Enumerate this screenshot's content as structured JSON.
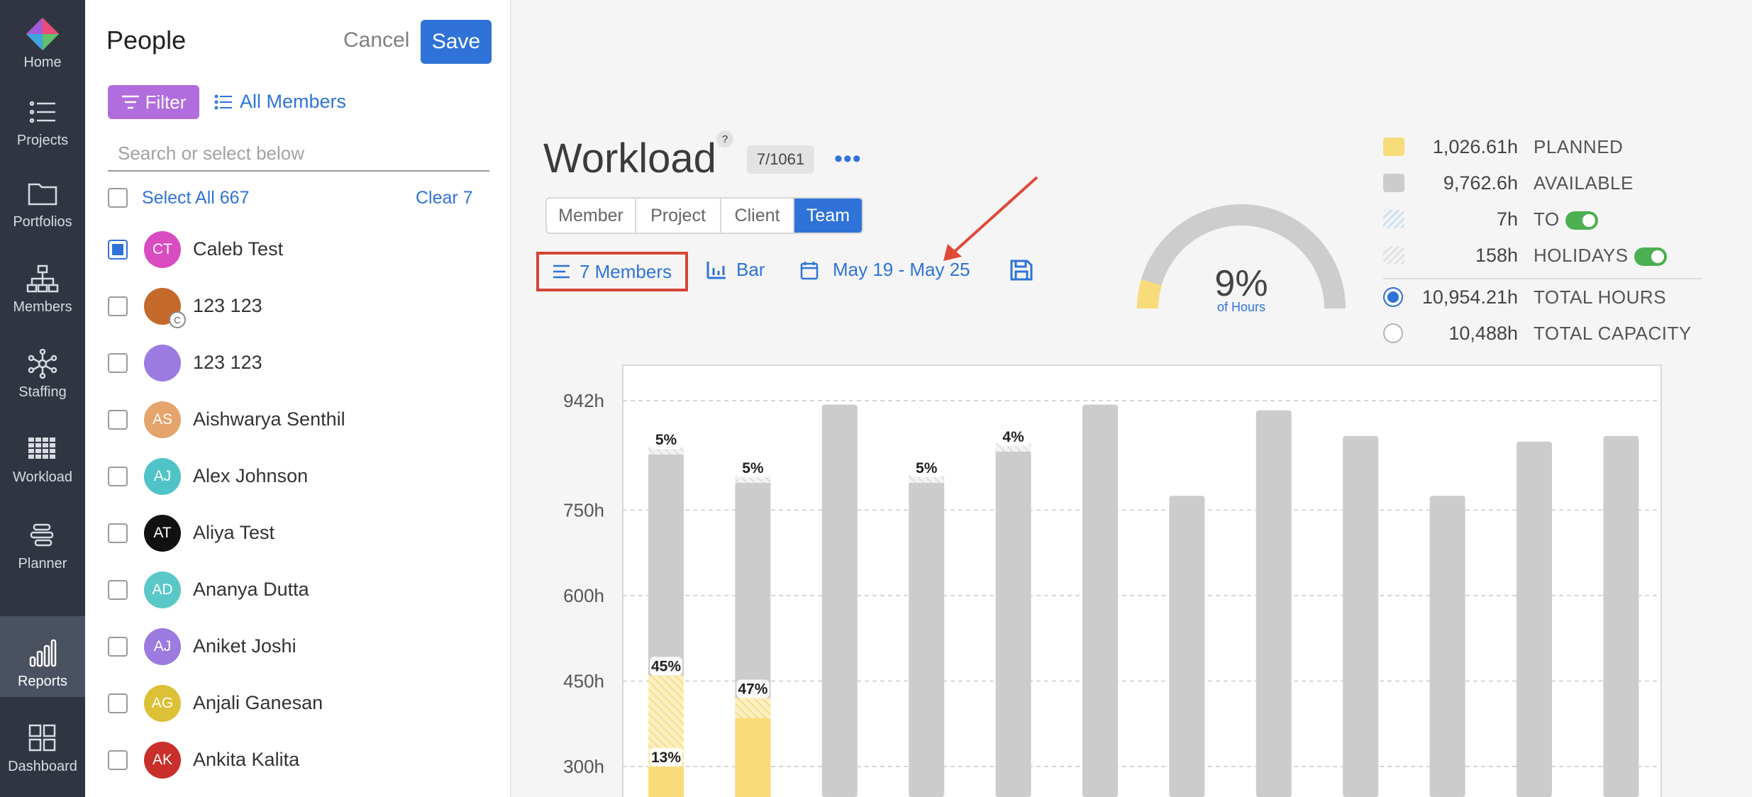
{
  "nav": {
    "items": [
      {
        "label": "Home",
        "icon": "logo-icon"
      },
      {
        "label": "Projects",
        "icon": "list-icon"
      },
      {
        "label": "Portfolios",
        "icon": "folder-icon"
      },
      {
        "label": "Members",
        "icon": "org-chart-icon"
      },
      {
        "label": "Staffing",
        "icon": "network-icon"
      },
      {
        "label": "Workload",
        "icon": "grid-icon"
      },
      {
        "label": "Planner",
        "icon": "planner-icon"
      },
      {
        "label": "Reports",
        "icon": "bar-chart-icon"
      },
      {
        "label": "Dashboard",
        "icon": "dashboard-icon"
      }
    ],
    "active": "Reports"
  },
  "people": {
    "title": "People",
    "cancel": "Cancel",
    "save": "Save",
    "filter": "Filter",
    "all_members": "All Members",
    "search_placeholder": "Search or select below",
    "select_all": "Select All 667",
    "clear": "Clear 7",
    "list": [
      {
        "name": "Caleb Test",
        "initials": "CT",
        "color": "#d94cc0",
        "checked": true
      },
      {
        "name": "123 123",
        "initials": "",
        "color": "#c5692b",
        "checked": false,
        "badge": "C"
      },
      {
        "name": "123 123",
        "initials": "",
        "color": "#9b7be0",
        "checked": false
      },
      {
        "name": "Aishwarya Senthil",
        "initials": "AS",
        "color": "#e5a46b",
        "checked": false
      },
      {
        "name": "Alex Johnson",
        "initials": "AJ",
        "color": "#4fc3c7",
        "checked": false
      },
      {
        "name": "Aliya Test",
        "initials": "AT",
        "color": "#111111",
        "checked": false
      },
      {
        "name": "Ananya Dutta",
        "initials": "AD",
        "color": "#5bc8c8",
        "checked": false
      },
      {
        "name": "Aniket Joshi",
        "initials": "AJ",
        "color": "#9b7be0",
        "checked": false
      },
      {
        "name": "Anjali Ganesan",
        "initials": "AG",
        "color": "#dcc035",
        "checked": false
      },
      {
        "name": "Ankita Kalita",
        "initials": "AK",
        "color": "#c9302c",
        "checked": false
      }
    ]
  },
  "workload": {
    "title": "Workload",
    "help": "?",
    "count_badge": "7/1061",
    "tabs": [
      "Member",
      "Project",
      "Client",
      "Team"
    ],
    "active_tab": "Team",
    "members_btn": "7 Members",
    "bar_btn": "Bar",
    "date_range": "May 19 - May 25",
    "gauge_pct": "9%",
    "gauge_fraction": 0.09,
    "gauge_sub": "of Hours"
  },
  "legend": {
    "planned": {
      "value": "1,026.61h",
      "label": "PLANNED",
      "color": "#f9dc7a"
    },
    "available": {
      "value": "9,762.6h",
      "label": "AVAILABLE",
      "color": "#cccccc"
    },
    "to": {
      "value": "7h",
      "label": "TO"
    },
    "holidays": {
      "value": "158h",
      "label": "HOLIDAYS"
    },
    "total_hours": {
      "value": "10,954.21h",
      "label": "TOTAL HOURS"
    },
    "total_capacity": {
      "value": "10,488h",
      "label": "TOTAL CAPACITY"
    }
  },
  "chart_data": {
    "type": "bar",
    "ylabels": [
      "942h",
      "750h",
      "600h",
      "450h",
      "300h"
    ],
    "yticks": [
      942,
      750,
      600,
      450,
      300
    ],
    "series_colors": {
      "available": "#cccccc",
      "planned": "#f9dc7a",
      "holiday": "#e8e8e8"
    },
    "bars": [
      {
        "total": 850,
        "planned": 300,
        "planned_hatched": 460,
        "label_top": "5%",
        "label_mid": "45%",
        "label_low": "13%"
      },
      {
        "total": 800,
        "planned": 385,
        "planned_hatched": 420,
        "label_top": "5%",
        "label_mid": "47%"
      },
      {
        "total": 935
      },
      {
        "total": 800,
        "label_top": "5%"
      },
      {
        "total": 855,
        "label_top": "4%"
      },
      {
        "total": 935
      },
      {
        "total": 775
      },
      {
        "total": 925
      },
      {
        "total": 880
      },
      {
        "total": 775
      },
      {
        "total": 870
      },
      {
        "total": 880
      }
    ]
  }
}
